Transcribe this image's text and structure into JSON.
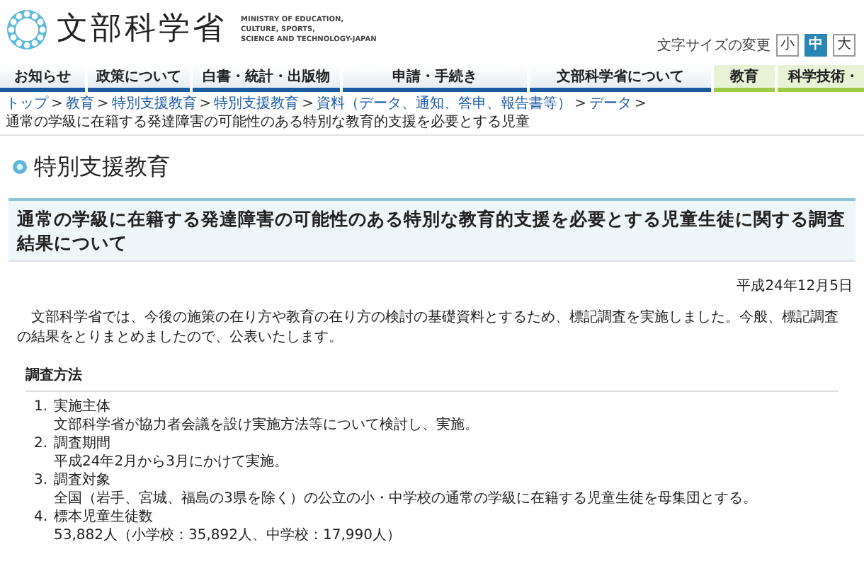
{
  "header": {
    "logo_text": "文部科学省",
    "logo_subtitle": [
      "MINISTRY OF EDUCATION,",
      "CULTURE, SPORTS,",
      "SCIENCE AND TECHNOLOGY-JAPAN"
    ],
    "font_size": {
      "label": "文字サイズの変更",
      "options": [
        {
          "label": "小",
          "selected": false
        },
        {
          "label": "中",
          "selected": true
        },
        {
          "label": "大",
          "selected": false
        }
      ]
    }
  },
  "nav": [
    {
      "label": "お知らせ",
      "kind": "main"
    },
    {
      "label": "政策について",
      "kind": "main"
    },
    {
      "label": "白書・統計・出版物",
      "kind": "main"
    },
    {
      "label": "申請・手続き",
      "kind": "main"
    },
    {
      "label": "文部科学省について",
      "kind": "main"
    },
    {
      "label": "教育",
      "kind": "field"
    },
    {
      "label": "科学技術・",
      "kind": "field"
    }
  ],
  "breadcrumb": [
    {
      "label": "トップ",
      "link": true
    },
    {
      "separator": ">",
      "label": "教育",
      "link": true
    },
    {
      "separator": ">",
      "label": "特別支援教育",
      "link": true
    },
    {
      "separator": ">",
      "label": "特別支援教育",
      "link": true
    },
    {
      "separator": ">",
      "label": "資料（データ、通知、答申、報告書等）",
      "link": true
    },
    {
      "separator": ">",
      "label": "データ",
      "link": true
    },
    {
      "separator": ">",
      "label": "通常の学級に在籍する発達障害の可能性のある特別な教育的支援を必要とする児童",
      "link": false
    }
  ],
  "page_heading": "特別支援教育",
  "title": "通常の学級に在籍する発達障害の可能性のある特別な教育的支援を必要とする児童生徒に関する調査結果について",
  "date": "平成24年12月5日",
  "intro": "文部科学省では、今後の施策の在り方や教育の在り方の検討の基礎資料とするため、標記調査を実施しました。今般、標記調査の結果をとりまとめましたので、公表いたします。",
  "section": {
    "heading": "調査方法",
    "items": [
      {
        "number": "1.",
        "term": "実施主体",
        "detail": "文部科学省が協力者会議を設け実施方法等について検討し、実施。"
      },
      {
        "number": "2.",
        "term": "調査期間",
        "detail": "平成24年2月から3月にかけて実施。"
      },
      {
        "number": "3.",
        "term": "調査対象",
        "detail": "全国（岩手、宮城、福島の3県を除く）の公立の小・中学校の通常の学級に在籍する児童生徒を母集団とする。"
      },
      {
        "number": "4.",
        "term": "標本児童生徒数",
        "detail": "53,882人（小学校：35,892人、中学校：17,990人）"
      }
    ]
  }
}
